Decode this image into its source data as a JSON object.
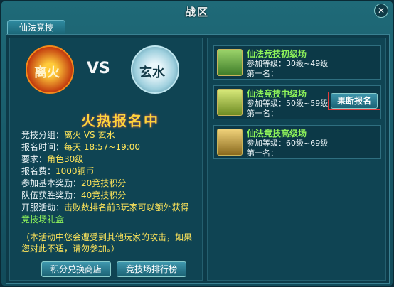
{
  "window": {
    "title": "战区"
  },
  "tabs": [
    {
      "label": "仙法竞技"
    }
  ],
  "left": {
    "emblem_fire_text": "离火",
    "emblem_water_text": "玄水",
    "vs_text": "VS",
    "headline": "火热报名中",
    "rows": [
      {
        "label": "竞技分组：",
        "value": "离火 VS 玄水"
      },
      {
        "label": "报名时间：",
        "value": "每天 18:57~19:00"
      },
      {
        "label": "要求：",
        "value": "角色30级"
      },
      {
        "label": "报名费：",
        "value": "1000铜币"
      },
      {
        "label": "参加基本奖励：",
        "value": "20竞技积分"
      },
      {
        "label": "队伍获胜奖励：",
        "value": "40竞技积分"
      },
      {
        "label": "开服活动：",
        "value": "击败数排名前3玩家可以额外获得"
      }
    ],
    "extra_reward": "竞技场礼盒",
    "note": "（本活动中您会遭受到其他玩家的攻击，如果您对此不适，请勿参加。）",
    "buttons": {
      "shop": "积分兑换商店",
      "leaderboard": "竞技场排行榜"
    }
  },
  "arenas": [
    {
      "name": "仙法竞技初级场",
      "level": "参加等级：30级~49级",
      "rank": "第一名："
    },
    {
      "name": "仙法竞技中级场",
      "level": "参加等级：50级~59级",
      "rank": "第一名：",
      "button": "果断报名"
    },
    {
      "name": "仙法竞技高级场",
      "level": "参加等级：60级~69级",
      "rank": "第一名："
    }
  ]
}
